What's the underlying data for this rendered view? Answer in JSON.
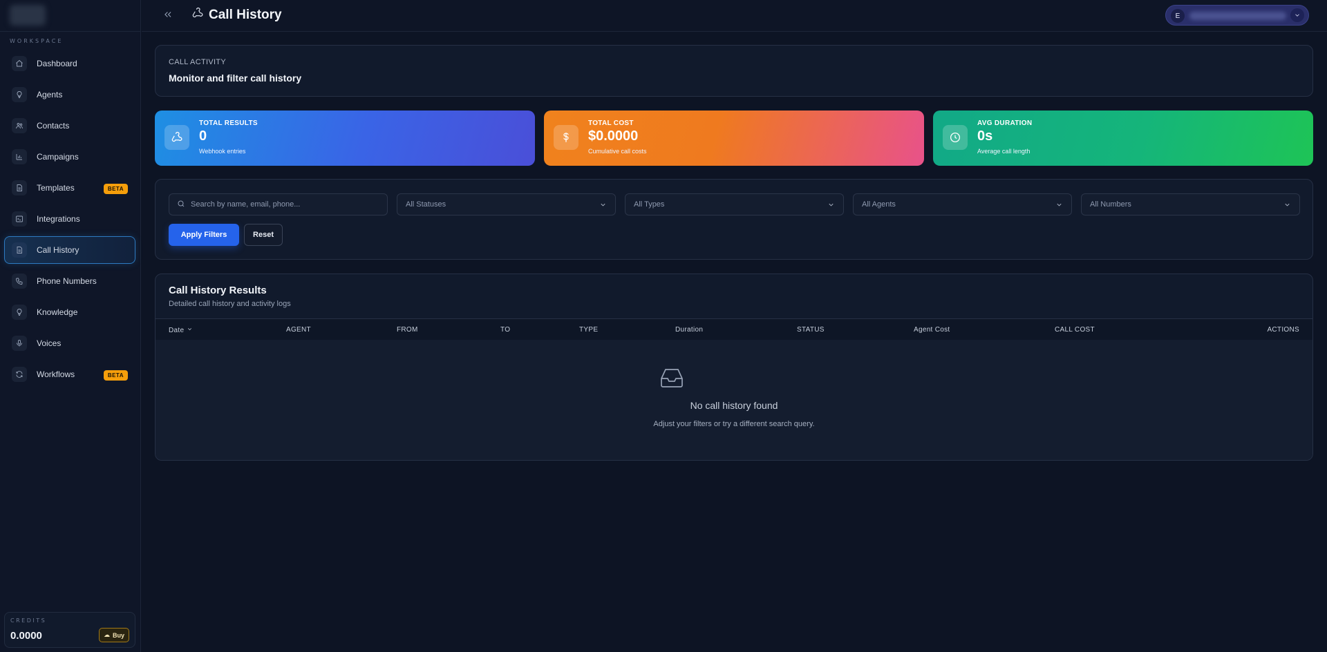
{
  "sidebar": {
    "workspace_label": "WORKSPACE",
    "items": [
      {
        "label": "Dashboard",
        "icon": "home-icon"
      },
      {
        "label": "Agents",
        "icon": "bulb-icon"
      },
      {
        "label": "Contacts",
        "icon": "contacts-icon"
      },
      {
        "label": "Campaigns",
        "icon": "bar-chart-icon"
      },
      {
        "label": "Templates",
        "icon": "document-icon",
        "badge": "BETA"
      },
      {
        "label": "Integrations",
        "icon": "terminal-icon"
      },
      {
        "label": "Call History",
        "icon": "document-icon",
        "active": true
      },
      {
        "label": "Phone Numbers",
        "icon": "phone-icon"
      },
      {
        "label": "Knowledge",
        "icon": "bulb-icon"
      },
      {
        "label": "Voices",
        "icon": "mic-icon"
      },
      {
        "label": "Workflows",
        "icon": "refresh-icon",
        "badge": "BETA"
      }
    ],
    "credits": {
      "label": "CREDITS",
      "value": "0.0000",
      "buy_label": "Buy"
    }
  },
  "header": {
    "title": "Call History",
    "user_initial": "E"
  },
  "activity": {
    "eyebrow": "CALL ACTIVITY",
    "title": "Monitor and filter call history"
  },
  "stats": [
    {
      "label": "TOTAL RESULTS",
      "value": "0",
      "sub": "Webhook entries",
      "icon": "webhook-icon",
      "color": "#3a64e6"
    },
    {
      "label": "TOTAL COST",
      "value": "$0.0000",
      "sub": "Cumulative call costs",
      "icon": "dollar-icon",
      "color": "#f0821d"
    },
    {
      "label": "AVG DURATION",
      "value": "0s",
      "sub": "Average call length",
      "icon": "clock-icon",
      "color": "#15b57a"
    }
  ],
  "filters": {
    "search_placeholder": "Search by name, email, phone...",
    "status": "All Statuses",
    "type": "All Types",
    "agent": "All Agents",
    "number": "All Numbers",
    "apply_label": "Apply Filters",
    "reset_label": "Reset"
  },
  "results": {
    "title": "Call History Results",
    "subtitle": "Detailed call history and activity logs",
    "columns": [
      "Date",
      "AGENT",
      "FROM",
      "TO",
      "TYPE",
      "Duration",
      "STATUS",
      "Agent Cost",
      "CALL COST",
      "ACTIONS"
    ],
    "empty_title": "No call history found",
    "empty_sub": "Adjust your filters or try a different search query."
  },
  "colors": {
    "accent": "#2563eb",
    "beta": "#f59e0b",
    "active_border": "#2d7bc2"
  }
}
